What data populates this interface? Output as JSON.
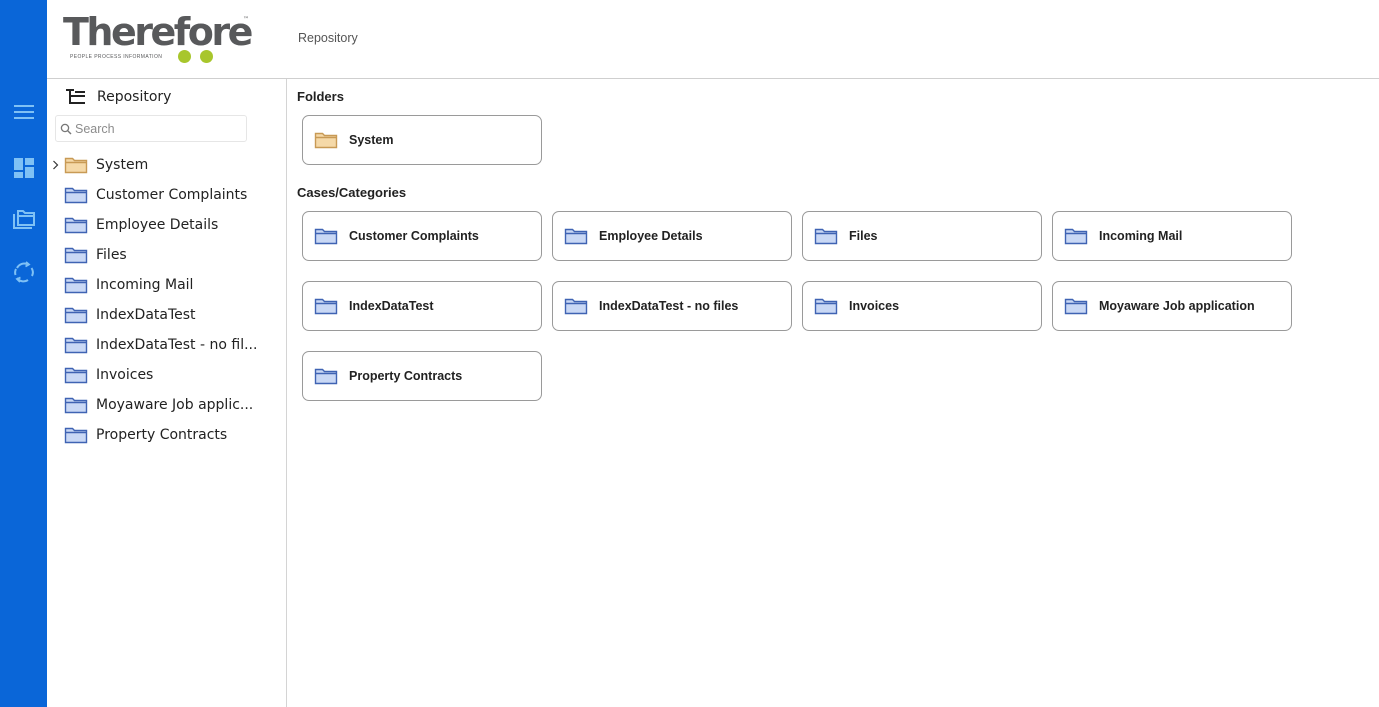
{
  "brand": {
    "logo_text": "Therefore",
    "logo_tm": "™",
    "logo_tagline": "PEOPLE  PROCESS  INFORMATION",
    "logo_dot_color": "#a8c62c",
    "rail_color": "#0a66d8"
  },
  "rail": {
    "items": [
      {
        "name": "menu-icon"
      },
      {
        "name": "dashboard-icon"
      },
      {
        "name": "folders-icon"
      },
      {
        "name": "sync-icon"
      }
    ]
  },
  "header": {
    "title": "Repository"
  },
  "sidebar": {
    "title": "Repository",
    "search_placeholder": "Search",
    "items": [
      {
        "label": "System",
        "icon": "folder-icon",
        "expandable": true
      },
      {
        "label": "Customer Complaints",
        "icon": "category-icon"
      },
      {
        "label": "Employee Details",
        "icon": "category-icon"
      },
      {
        "label": "Files",
        "icon": "category-icon"
      },
      {
        "label": "Incoming Mail",
        "icon": "category-icon"
      },
      {
        "label": "IndexDataTest",
        "icon": "category-icon"
      },
      {
        "label": "IndexDataTest - no fil...",
        "icon": "category-icon"
      },
      {
        "label": "Invoices",
        "icon": "category-icon"
      },
      {
        "label": "Moyaware Job applic...",
        "icon": "category-icon"
      },
      {
        "label": "Property Contracts",
        "icon": "category-icon"
      }
    ]
  },
  "main": {
    "folders_title": "Folders",
    "folders": [
      {
        "label": "System"
      }
    ],
    "categories_title": "Cases/Categories",
    "categories": [
      {
        "label": "Customer Complaints"
      },
      {
        "label": "Employee Details"
      },
      {
        "label": "Files"
      },
      {
        "label": "Incoming Mail"
      },
      {
        "label": "IndexDataTest"
      },
      {
        "label": "IndexDataTest - no files"
      },
      {
        "label": "Invoices"
      },
      {
        "label": "Moyaware Job application"
      },
      {
        "label": "Property Contracts"
      }
    ]
  },
  "colors": {
    "folder_fill": "#f5d9a8",
    "folder_stroke": "#c89a55",
    "category_fill": "#c9d8f5",
    "category_stroke": "#3f63b3"
  }
}
